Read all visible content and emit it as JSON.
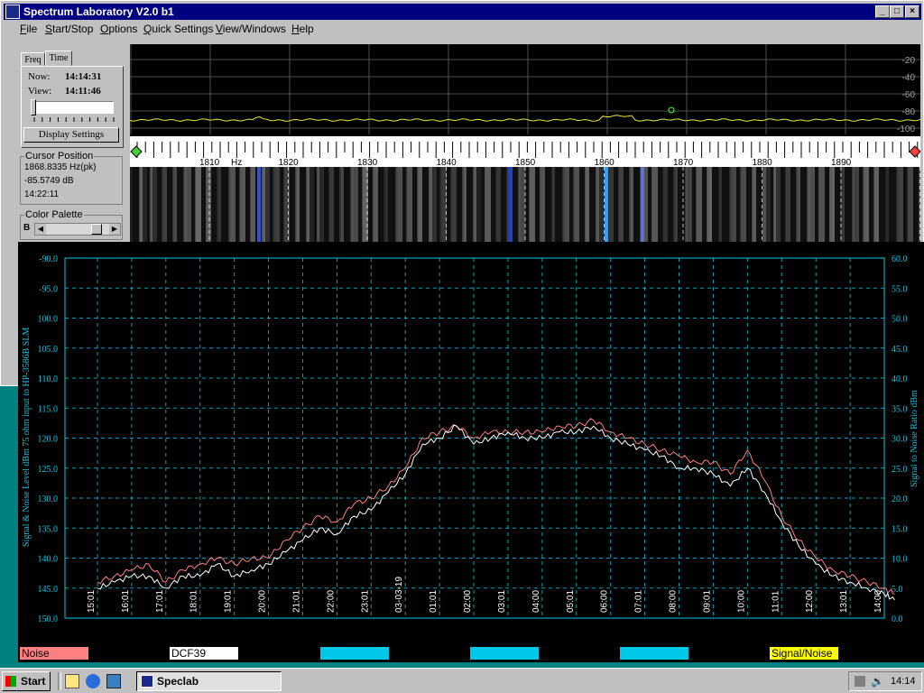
{
  "window": {
    "title": "Spectrum Laboratory V2.0 b1",
    "min": "_",
    "max": "□",
    "close": "×"
  },
  "menu": [
    {
      "label": "File",
      "u": "F",
      "rest": "ile"
    },
    {
      "label": "Start/Stop",
      "u": "S",
      "rest": "tart/Stop"
    },
    {
      "label": "Options",
      "u": "O",
      "rest": "ptions"
    },
    {
      "label": "Quick Settings",
      "u": "Q",
      "rest": "uick Settings"
    },
    {
      "label": "View/Windows",
      "u": "V",
      "rest": "iew/Windows"
    },
    {
      "label": "Help",
      "u": "H",
      "rest": "elp"
    }
  ],
  "tabs": {
    "freq": "Freq",
    "time": "Time"
  },
  "time_panel": {
    "now_label": "Now:",
    "now_value": "14:14:31",
    "view_label": "View:",
    "view_value": "14:11:46",
    "display_settings": "Display Settings"
  },
  "cursor": {
    "title": "Cursor Position",
    "freq": "1868.8335 Hz(pk)",
    "level": "-85.5749 dB",
    "time": "14:22:11"
  },
  "palette": {
    "title": "Color Palette",
    "letter": "B"
  },
  "spectrum": {
    "db_labels": [
      "-20",
      "-40",
      "-60",
      "-80",
      "-100"
    ],
    "freq_labels": [
      "1810",
      "1820",
      "1830",
      "1840",
      "1850",
      "1860",
      "1870",
      "1880",
      "1890"
    ],
    "freq_unit": "Hz"
  },
  "chart_data": {
    "type": "line",
    "ylabel_left": "Signal & Noise Level dBm 75 ohm input to HP-3586B SLM",
    "ylabel_right": "Signal to Noise Ratio  dBm",
    "y_left_ticks": [
      "-90.0",
      "-95.0",
      "100.0",
      "105.0",
      "110.0",
      "115.0",
      "120.0",
      "125.0",
      "130.0",
      "135.0",
      "140.0",
      "145.0",
      "150.0"
    ],
    "y_right_ticks": [
      "60.0",
      "55.0",
      "50.0",
      "45.0",
      "40.0",
      "35.0",
      "30.0",
      "25.0",
      "20.0",
      "15.0",
      "10.0",
      "5.0",
      "0.0"
    ],
    "ylim_left": [
      -150,
      -90
    ],
    "ylim_right": [
      0,
      60
    ],
    "x_ticks": [
      "15:01",
      "16:01",
      "17:01",
      "18:01",
      "19:01",
      "20:00",
      "21:01",
      "22:00",
      "23:01",
      "03-03-19",
      "01:01",
      "02:00",
      "03:01",
      "04:00",
      "05:01",
      "06:00",
      "07:01",
      "08:00",
      "09:01",
      "10:00",
      "11:01",
      "12:00",
      "13:01",
      "14:00"
    ],
    "grid": true,
    "series": [
      {
        "name": "Noise",
        "color": "#ff8080",
        "hours": [
          0,
          0.5,
          1,
          1.5,
          2,
          2.5,
          3,
          3.5,
          4,
          4.5,
          5,
          5.5,
          6,
          6.5,
          7,
          7.5,
          8,
          8.5,
          9,
          9.5,
          10,
          10.5,
          11,
          11.5,
          12,
          12.5,
          13,
          13.5,
          14,
          14.5,
          15,
          15.5,
          16,
          16.5,
          17,
          17.5,
          18,
          18.5,
          19,
          19.5,
          20,
          20.5,
          21,
          21.5,
          22,
          22.5,
          23,
          23.3
        ],
        "values": [
          -144,
          -143,
          -142,
          -141,
          -144,
          -142,
          -141,
          -140,
          -141,
          -140,
          -140,
          -137,
          -135,
          -133,
          -134,
          -131,
          -130,
          -128,
          -125,
          -120,
          -119,
          -118,
          -120,
          -119,
          -119,
          -119,
          -119,
          -118,
          -118,
          -117,
          -119,
          -120,
          -121,
          -122,
          -123,
          -124,
          -124,
          -126,
          -122,
          -127,
          -133,
          -137,
          -140,
          -142,
          -143,
          -144,
          -145,
          -146
        ]
      },
      {
        "name": "DCF39",
        "color": "#ffffff",
        "hours": [
          0,
          0.5,
          1,
          1.5,
          2,
          2.5,
          3,
          3.5,
          4,
          4.5,
          5,
          5.5,
          6,
          6.5,
          7,
          7.5,
          8,
          8.5,
          9,
          9.5,
          10,
          10.5,
          11,
          11.5,
          12,
          12.5,
          13,
          13.5,
          14,
          14.5,
          15,
          15.5,
          16,
          16.5,
          17,
          17.5,
          18,
          18.5,
          19,
          19.5,
          20,
          20.5,
          21,
          21.5,
          22,
          22.5,
          23,
          23.3
        ],
        "values": [
          -145,
          -144,
          -143,
          -143,
          -145,
          -143,
          -143,
          -141,
          -143,
          -142,
          -141,
          -139,
          -137,
          -135,
          -136,
          -133,
          -132,
          -129,
          -126,
          -121,
          -120,
          -118,
          -121,
          -120,
          -119,
          -120,
          -120,
          -119,
          -119,
          -118,
          -120,
          -121,
          -122,
          -123,
          -125,
          -125,
          -126,
          -128,
          -125,
          -129,
          -134,
          -138,
          -141,
          -143,
          -144,
          -145,
          -146,
          -147
        ]
      }
    ],
    "legend": [
      "Noise",
      "DCF39",
      "",
      "",
      "",
      "Signal/Noise"
    ],
    "legend_colors": [
      "#ff8080",
      "#ffffff",
      "#00c8e8",
      "#00c8e8",
      "#00c8e8",
      "#ffff00"
    ]
  },
  "taskbar": {
    "start": "Start",
    "task": "Speclab",
    "clock": "14:14"
  }
}
